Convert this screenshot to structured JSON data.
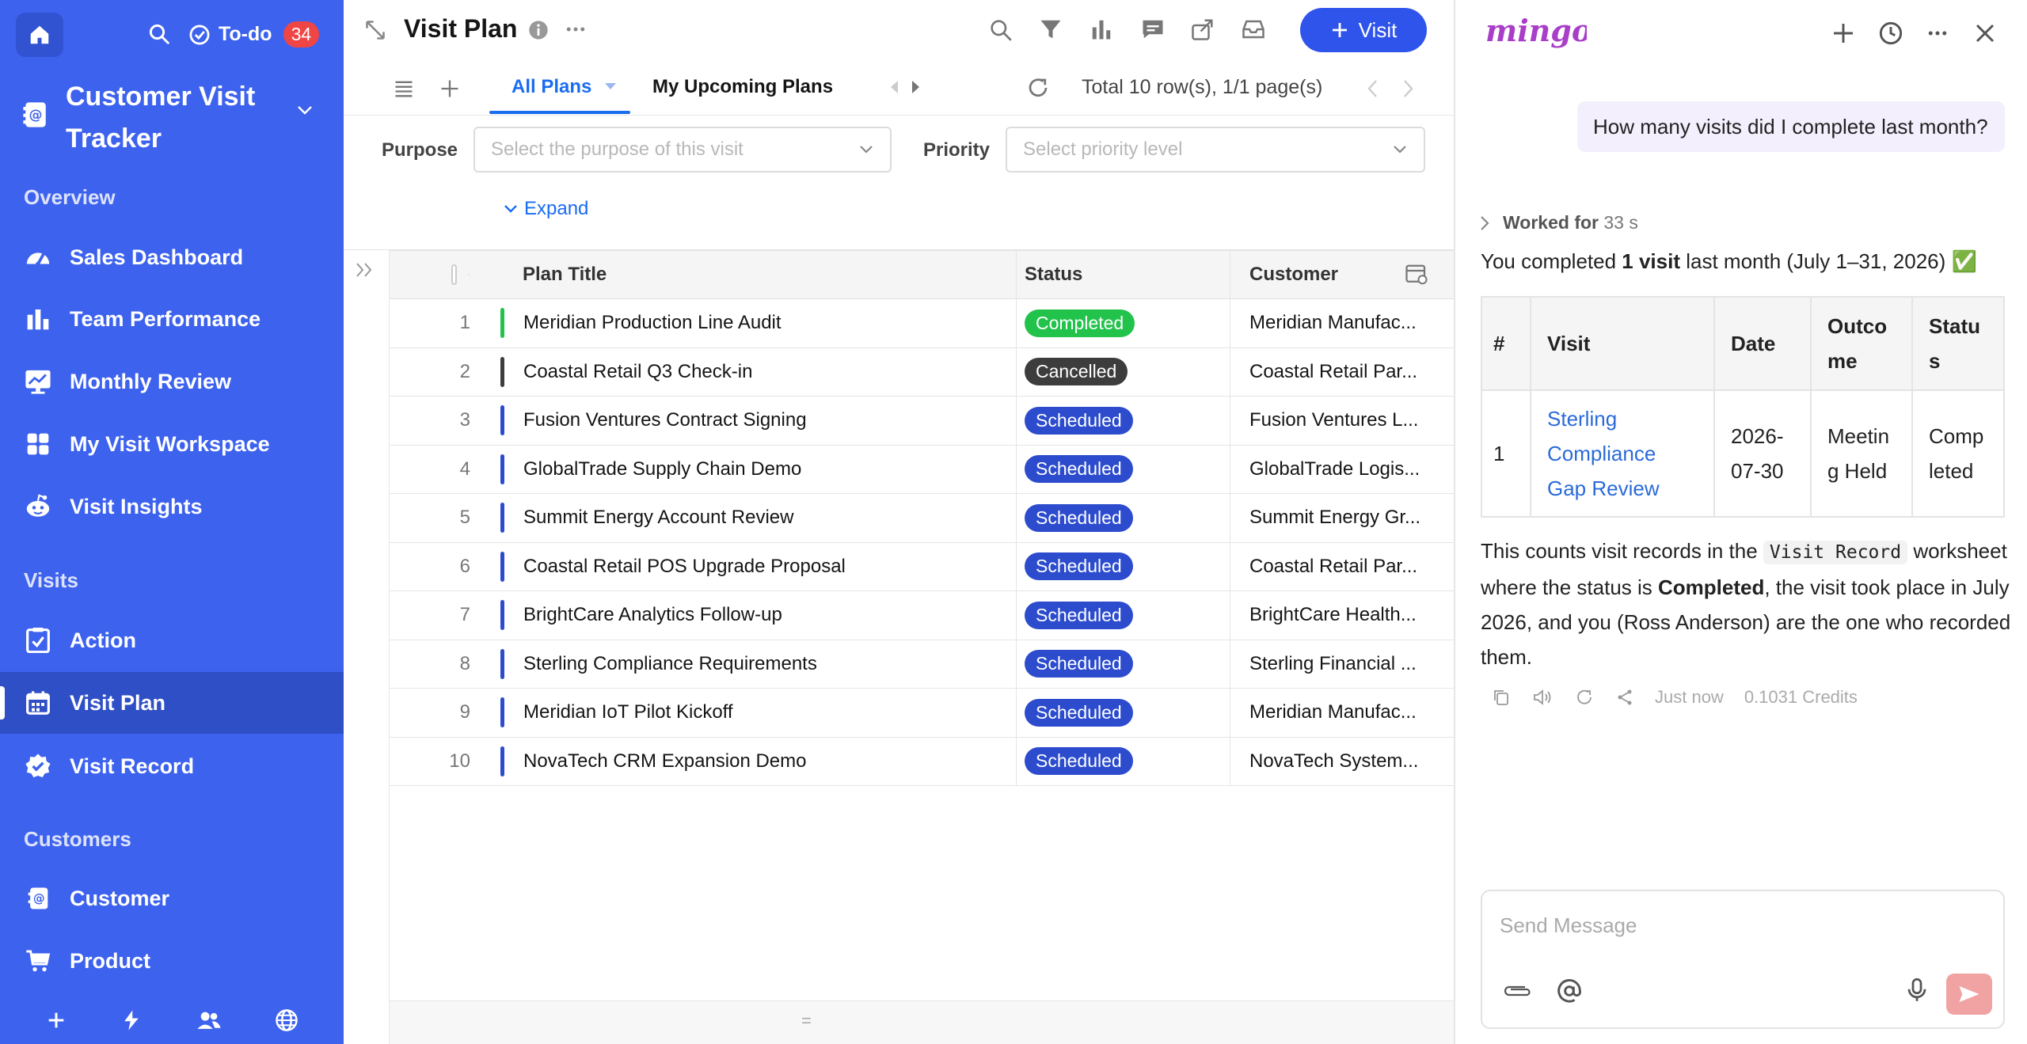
{
  "sidebar": {
    "todo_label": "To-do",
    "todo_count": "34",
    "app_title": "Customer Visit Tracker",
    "sections": [
      "Overview",
      "Visits",
      "Customers"
    ],
    "items": [
      {
        "label": "Sales Dashboard",
        "icon": "dashboard-icon"
      },
      {
        "label": "Team Performance",
        "icon": "bar-chart-icon"
      },
      {
        "label": "Monthly Review",
        "icon": "trend-chart-icon"
      },
      {
        "label": "My Visit Workspace",
        "icon": "grid-icon"
      },
      {
        "label": "Visit Insights",
        "icon": "reddit-icon"
      },
      {
        "label": "Action",
        "icon": "checklist-icon"
      },
      {
        "label": "Visit Plan",
        "icon": "calendar-icon",
        "active": true
      },
      {
        "label": "Visit Record",
        "icon": "verified-icon"
      },
      {
        "label": "Customer",
        "icon": "contact-icon"
      },
      {
        "label": "Product",
        "icon": "cart-icon"
      }
    ]
  },
  "main": {
    "title": "Visit Plan",
    "visit_button": "Visit",
    "tabs": [
      "All Plans",
      "My Upcoming Plans"
    ],
    "total": "Total 10 row(s), 1/1 page(s)",
    "filters": {
      "purpose_label": "Purpose",
      "purpose_placeholder": "Select the purpose of this visit",
      "priority_label": "Priority",
      "priority_placeholder": "Select priority level",
      "expand": "Expand"
    },
    "columns": [
      "Plan Title",
      "Status",
      "Customer"
    ],
    "rows": [
      {
        "n": "1",
        "title": "Meridian Production Line Audit",
        "status": "Completed",
        "customer": "Meridian Manufac..."
      },
      {
        "n": "2",
        "title": "Coastal Retail Q3 Check-in",
        "status": "Cancelled",
        "customer": "Coastal Retail Par..."
      },
      {
        "n": "3",
        "title": "Fusion Ventures Contract Signing",
        "status": "Scheduled",
        "customer": "Fusion Ventures L..."
      },
      {
        "n": "4",
        "title": "GlobalTrade Supply Chain Demo",
        "status": "Scheduled",
        "customer": "GlobalTrade Logis..."
      },
      {
        "n": "5",
        "title": "Summit Energy Account Review",
        "status": "Scheduled",
        "customer": "Summit Energy Gr..."
      },
      {
        "n": "6",
        "title": "Coastal Retail POS Upgrade Proposal",
        "status": "Scheduled",
        "customer": "Coastal Retail Par..."
      },
      {
        "n": "7",
        "title": "BrightCare Analytics Follow-up",
        "status": "Scheduled",
        "customer": "BrightCare Health..."
      },
      {
        "n": "8",
        "title": "Sterling Compliance Requirements",
        "status": "Scheduled",
        "customer": "Sterling Financial ..."
      },
      {
        "n": "9",
        "title": "Meridian IoT Pilot Kickoff",
        "status": "Scheduled",
        "customer": "Meridian Manufac..."
      },
      {
        "n": "10",
        "title": "NovaTech CRM Expansion Demo",
        "status": "Scheduled",
        "customer": "NovaTech System..."
      }
    ],
    "status_colors": {
      "Completed": "#22c34b",
      "Cancelled": "#3d3d3d",
      "Scheduled": "#2c4ccd"
    },
    "footer_symbol": "="
  },
  "chat": {
    "logo": "mingo",
    "user_question": "How many visits did I complete last month?",
    "worked_label": "Worked for",
    "worked_time": "33 s",
    "answer_pre": "You completed ",
    "answer_bold": "1 visit",
    "answer_post": " last month (July 1–31, 2026) ✅",
    "table_headers": [
      "#",
      "Visit",
      "Date",
      "Outcome",
      "Status"
    ],
    "table_row": {
      "n": "1",
      "visit": "Sterling Compliance Gap Review",
      "date": "2026-07-30",
      "outcome": "Meeting Held",
      "status": "Completed"
    },
    "para_1": "This counts visit records in the ",
    "para_code": "Visit Record",
    "para_2": " worksheet where the status is ",
    "para_bold": "Completed",
    "para_3": ", the visit took place in July 2026, and you (Ross Anderson) are the one who recorded them.",
    "meta_time": "Just now",
    "meta_credits": "0.1031 Credits",
    "input_placeholder": "Send Message"
  }
}
